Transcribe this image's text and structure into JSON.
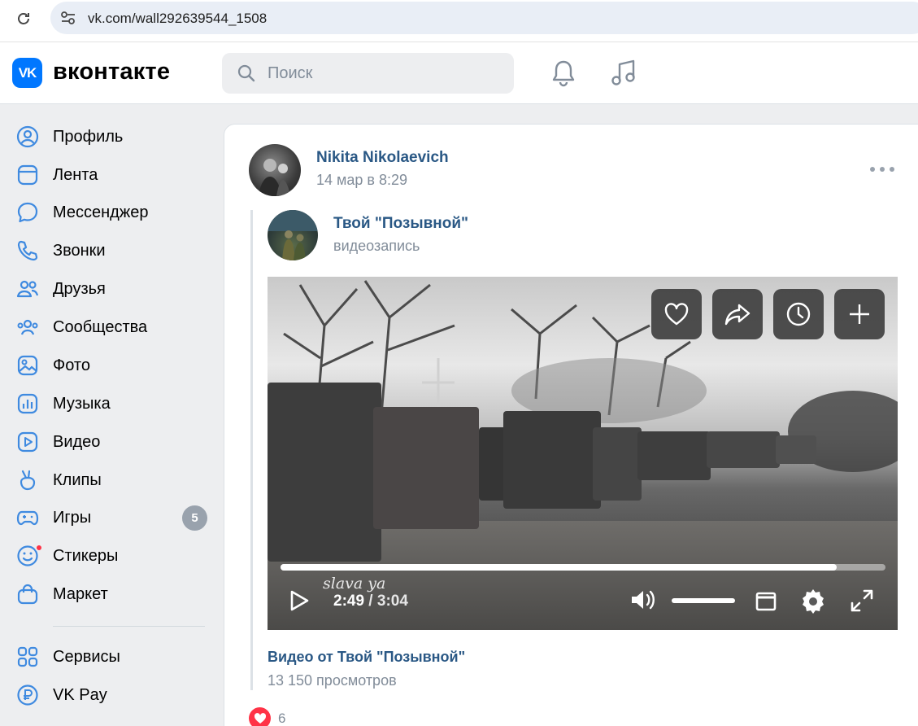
{
  "browser": {
    "url": "vk.com/wall292639544_1508"
  },
  "header": {
    "logo_mark": "VK",
    "logo_text": "вконтакте",
    "search_placeholder": "Поиск"
  },
  "sidebar": {
    "items": [
      {
        "label": "Профиль",
        "icon": "profile-icon"
      },
      {
        "label": "Лента",
        "icon": "feed-icon"
      },
      {
        "label": "Мессенджер",
        "icon": "messenger-icon"
      },
      {
        "label": "Звонки",
        "icon": "phone-icon"
      },
      {
        "label": "Друзья",
        "icon": "friends-icon"
      },
      {
        "label": "Сообщества",
        "icon": "communities-icon"
      },
      {
        "label": "Фото",
        "icon": "photo-icon"
      },
      {
        "label": "Музыка",
        "icon": "music-icon"
      },
      {
        "label": "Видео",
        "icon": "video-icon"
      },
      {
        "label": "Клипы",
        "icon": "clips-icon"
      },
      {
        "label": "Игры",
        "icon": "games-icon",
        "badge": "5"
      },
      {
        "label": "Стикеры",
        "icon": "stickers-icon"
      },
      {
        "label": "Маркет",
        "icon": "market-icon"
      },
      {
        "label": "Сервисы",
        "icon": "services-icon"
      },
      {
        "label": "VK Pay",
        "icon": "vkpay-icon"
      }
    ]
  },
  "post": {
    "author": "Nikita Nikolaevich",
    "date": "14 мар в 8:29",
    "repost": {
      "name": "Твой \"Позывной\"",
      "subtitle": "видеозапись"
    },
    "video": {
      "watermark": "slava ya",
      "current_time": "2:49",
      "separator": " / ",
      "duration": "3:04",
      "progress": 0.92,
      "title": "Видео от Твой \"Позывной\"",
      "views": "13 150 просмотров"
    },
    "likes": "6"
  },
  "colors": {
    "accent": "#0077ff",
    "link": "#2a5885",
    "secondary_text": "#818c99",
    "like": "#ff3347"
  }
}
